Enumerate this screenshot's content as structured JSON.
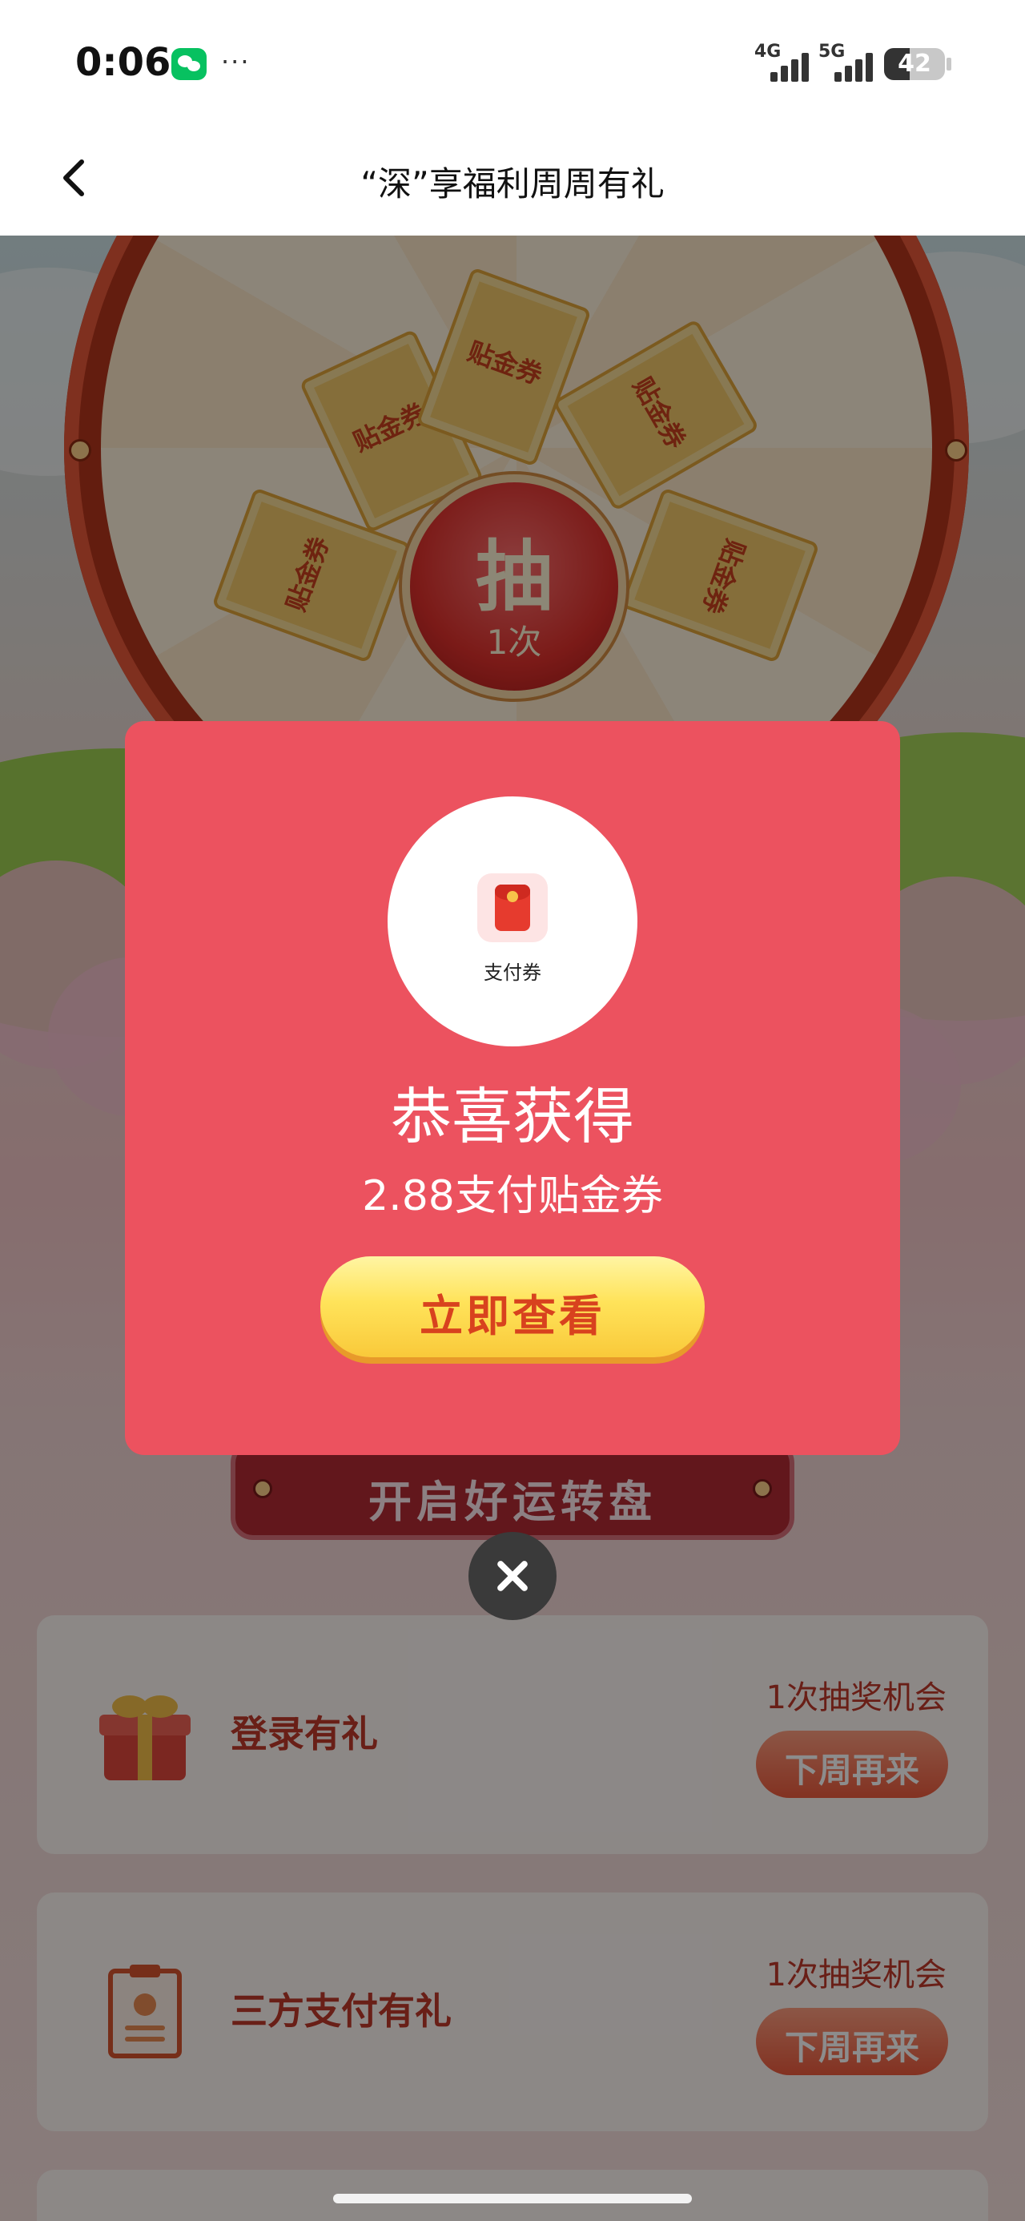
{
  "status_bar": {
    "time": "0:06",
    "more": "···",
    "net1": "4G",
    "net2": "5G",
    "battery": "42",
    "battery_level": 0.42,
    "app_icon": "wechat-icon"
  },
  "header": {
    "title": "“深”享福利周周有礼",
    "back_icon": "chevron-left-icon"
  },
  "wheel": {
    "hub_top": "抽",
    "hub_bottom": "1次",
    "ticket_label": "贴金券"
  },
  "start_banner": "开启好运转盘",
  "tasks": [
    {
      "name": "登录有礼",
      "chance": "1次抽奖机会",
      "button": "下周再来",
      "icon": "gift-box-icon"
    },
    {
      "name": "三方支付有礼",
      "chance": "1次抽奖机会",
      "button": "下周再来",
      "icon": "clipboard-icon"
    }
  ],
  "modal": {
    "prize_label": "支付券",
    "title": "恭喜获得",
    "description": "2.88支付贴金券",
    "button": "立即查看",
    "close_icon": "close-icon"
  },
  "colors": {
    "modal_bg": "#ec525f",
    "button_yellow": "#ffe35a",
    "button_text": "#d8421e",
    "wheel_red": "#b5361c"
  }
}
